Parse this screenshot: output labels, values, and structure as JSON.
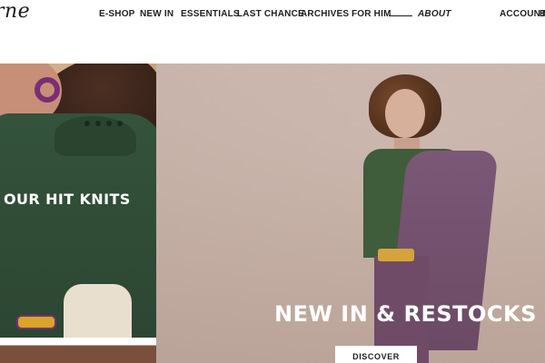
{
  "brand": {
    "logo_text": "rne"
  },
  "nav": {
    "items": [
      {
        "label": "E-SHOP"
      },
      {
        "label": "NEW IN"
      },
      {
        "label": "ESSENTIALS"
      },
      {
        "label": "LAST CHANCE"
      },
      {
        "label": "ARCHIVES"
      },
      {
        "label": "FOR HIM"
      },
      {
        "label": "ABOUT"
      }
    ],
    "account_label": "ACCOUNT",
    "truncated_right_label": "B"
  },
  "promos": {
    "left_title": "OUR HIT KNITS",
    "hero_title": "NEW IN & RESTOCKS",
    "hero_button_label": "DISCOVER"
  },
  "colors": {
    "text": "#1f1f1f",
    "background": "#ffffff"
  }
}
